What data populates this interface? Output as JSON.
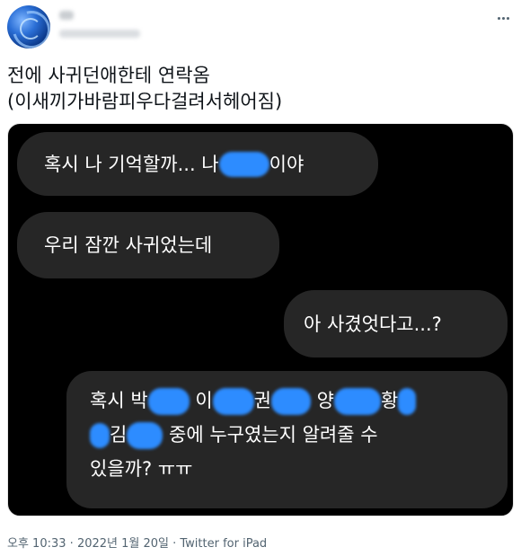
{
  "tweet": {
    "text_line1": "전에 사귀던애한테 연락옴",
    "text_line2": "(이새끼가바람피우다걸려서헤어짐)"
  },
  "chat": {
    "msg1_a": "혹시 나 기억할까... 나 ",
    "msg1_b": "이야",
    "msg2": "우리 잠깐 사귀었는데",
    "msg3": "아 사겼엇다고...?",
    "msg4_line1_a": "혹시 박",
    "msg4_line1_b": " 이",
    "msg4_line1_c": "권",
    "msg4_line1_d": " 양",
    "msg4_line1_e": "황",
    "msg4_line2_a": "김",
    "msg4_line2_b": " 중에 누구였는지 알려줄 수",
    "msg4_line3": "있을까? ㅠㅠ"
  },
  "footer": {
    "time": "오후 10:33",
    "sep1": " · ",
    "date": "2022년 1월 20일",
    "sep2": " · ",
    "source": "Twitter for iPad"
  },
  "colors": {
    "redaction": "#2d8cff",
    "bubble": "#262626",
    "background_media": "#000000"
  },
  "icons": {
    "more": "more-horizontal-icon"
  }
}
